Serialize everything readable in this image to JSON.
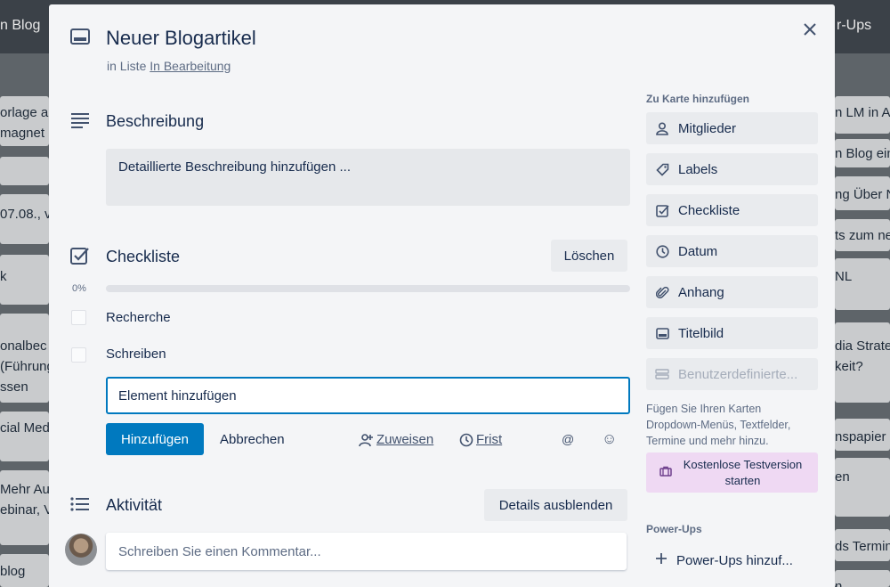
{
  "background": {
    "top_left": "n Blog",
    "top_right": "r-Ups",
    "left_fragments": [
      "orlage a",
      "magnet",
      "07.08., v",
      "k",
      "onalbec",
      "(Führung",
      "ssen",
      "cial Med",
      "Mehr Au",
      "ebinar, V",
      "blog"
    ],
    "right_fragments": [
      "n LM in A",
      "n Blog ein",
      "ng Über N",
      "ts zum ne",
      "NL",
      "dia Strate",
      "keit?",
      "nspapier",
      "en",
      "ds Termin",
      "n"
    ]
  },
  "card": {
    "title": "Neuer Blogartikel",
    "in_list_prefix": "in Liste",
    "list_name": "In Bearbeitung"
  },
  "description": {
    "title": "Beschreibung",
    "placeholder": "Detaillierte Beschreibung hinzufügen ..."
  },
  "checklist": {
    "title": "Checkliste",
    "delete_label": "Löschen",
    "progress_label": "0%",
    "progress": 0,
    "items": [
      {
        "label": "Recherche",
        "checked": false
      },
      {
        "label": "Schreiben",
        "checked": false
      }
    ],
    "add_value": "Element hinzufügen",
    "add_button": "Hinzufügen",
    "cancel_button": "Abbrechen",
    "assign_label": "Zuweisen",
    "due_label": "Frist",
    "mention_icon": "@",
    "emoji_icon": "☺"
  },
  "activity": {
    "title": "Aktivität",
    "hide_details": "Details ausblenden",
    "comment_placeholder": "Schreiben Sie einen Kommentar..."
  },
  "sidebar": {
    "add_heading": "Zu Karte hinzufügen",
    "buttons": [
      {
        "label": "Mitglieder",
        "icon": "person-icon"
      },
      {
        "label": "Labels",
        "icon": "tag-icon"
      },
      {
        "label": "Checkliste",
        "icon": "checkbox-icon"
      },
      {
        "label": "Datum",
        "icon": "clock-icon"
      },
      {
        "label": "Anhang",
        "icon": "paperclip-icon"
      },
      {
        "label": "Titelbild",
        "icon": "card-cover-icon"
      },
      {
        "label": "Benutzerdefinierte...",
        "icon": "custom-fields-icon"
      }
    ],
    "note": "Fügen Sie Ihren Karten Dropdown-Menüs, Textfelder, Termine und mehr hinzu.",
    "trial_label": "Kostenlose Testversion starten",
    "powerups_heading": "Power-Ups",
    "powerups_add": "Power-Ups hinzuf..."
  },
  "colors": {
    "primary": "#0079bf",
    "trial_bg": "#efd9f3",
    "modal_bg": "#f4f5f7"
  }
}
